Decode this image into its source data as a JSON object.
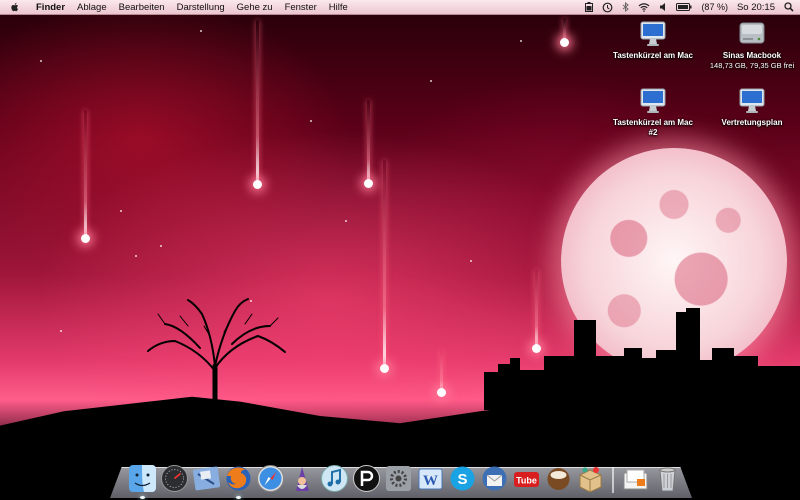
{
  "menubar": {
    "app_name": "Finder",
    "menus": [
      "Ablage",
      "Bearbeiten",
      "Darstellung",
      "Gehe zu",
      "Fenster",
      "Hilfe"
    ],
    "battery": "(87 %)",
    "clock": "So 20:15",
    "status_icons": [
      "battery-indicator-icon",
      "time-machine-icon",
      "bluetooth-icon",
      "wifi-icon",
      "volume-icon",
      "battery-icon",
      "spotlight-icon"
    ]
  },
  "desktop": {
    "icons": [
      {
        "label": "Tastenkürzel am Mac",
        "icon": "imac-icon"
      },
      {
        "label": "Sinas Macbook",
        "sub": "148,73 GB, 79,35 GB frei",
        "icon": "hard-drive-icon"
      },
      {
        "label": "Tastenkürzel am Mac",
        "label2": "#2",
        "icon": "imac-icon"
      },
      {
        "label": "Vertretungsplan",
        "icon": "imac-icon"
      }
    ]
  },
  "dock": {
    "items": [
      "finder",
      "dashboard",
      "mail",
      "firefox",
      "safari",
      "wizard",
      "itunes",
      "pidgin",
      "system-preferences",
      "word",
      "skype",
      "thunderbird",
      "youtube",
      "coconut",
      "package"
    ],
    "right_items": [
      "documents-stack",
      "trash"
    ],
    "youtube_label": "Tube"
  },
  "colors": {
    "menubar_bg": "#f2d4dc",
    "sky_accent": "#e23a6a"
  }
}
